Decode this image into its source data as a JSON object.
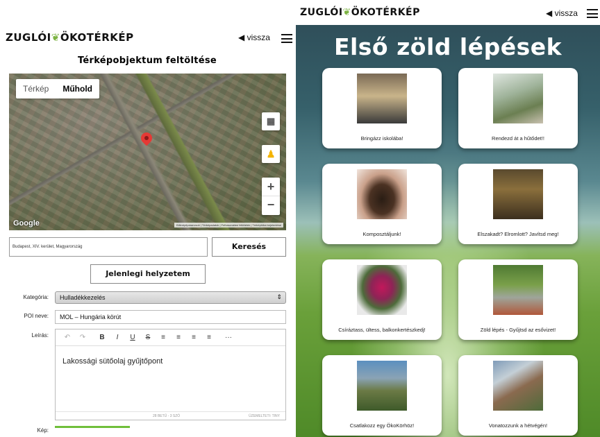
{
  "left": {
    "header": {
      "brand_left": "ZUGLÓI",
      "brand_right": "ÖKOTÉRKÉP",
      "back": "vissza"
    },
    "title": "Térképobjektum feltöltése",
    "map": {
      "tab_map": "Térkép",
      "tab_satellite": "Műhold",
      "google": "Google",
      "attribution": "Billentyűparancsok | Térképadatok | Felhasználási feltételek | Térképhiba bejelentése"
    },
    "address": "Budapest, XIV. kerület, Magyarország",
    "search_button": "Keresés",
    "location_button": "Jelenlegi helyzetem",
    "form": {
      "category_label": "Kategória:",
      "category_value": "Hulladékkezelés",
      "poi_label": "POI neve:",
      "poi_value": "MOL – Hungária körút",
      "desc_label": "Leírás:",
      "desc_value": "Lakossági sütőolaj gyűjtőpont",
      "word_count": "28 BETŰ - 3 SZÓ",
      "powered_by": "ÜZEMELTETI: TINY",
      "image_label": "Kép:"
    },
    "toolbar": [
      "↶",
      "↷",
      "B",
      "I",
      "U",
      "S",
      "≡",
      "≡",
      "≡",
      "≡",
      "···"
    ]
  },
  "right": {
    "header": {
      "brand_left": "ZUGLÓI",
      "brand_right": "ÖKOTÉRKÉP",
      "back": "vissza"
    },
    "title": "Első zöld lépések",
    "cards": [
      {
        "label": "Bringázz iskolába!"
      },
      {
        "label": "Rendezd át a hűtődet!!"
      },
      {
        "label": "Komposztáljunk!"
      },
      {
        "label": "Elszakadt? Elromlott? Javítsd meg!"
      },
      {
        "label": "Csíráztass, ültess, balkonkertészkedj!"
      },
      {
        "label": "Zöld lépés - Gyűjtsd az esővizet!"
      },
      {
        "label": "Csatlakozz egy ÖkoKörhöz!"
      },
      {
        "label": "Vonatozzunk a hétvégén!"
      }
    ]
  },
  "colors": {
    "accent_green": "#7cb342",
    "pin_red": "#e53935"
  }
}
